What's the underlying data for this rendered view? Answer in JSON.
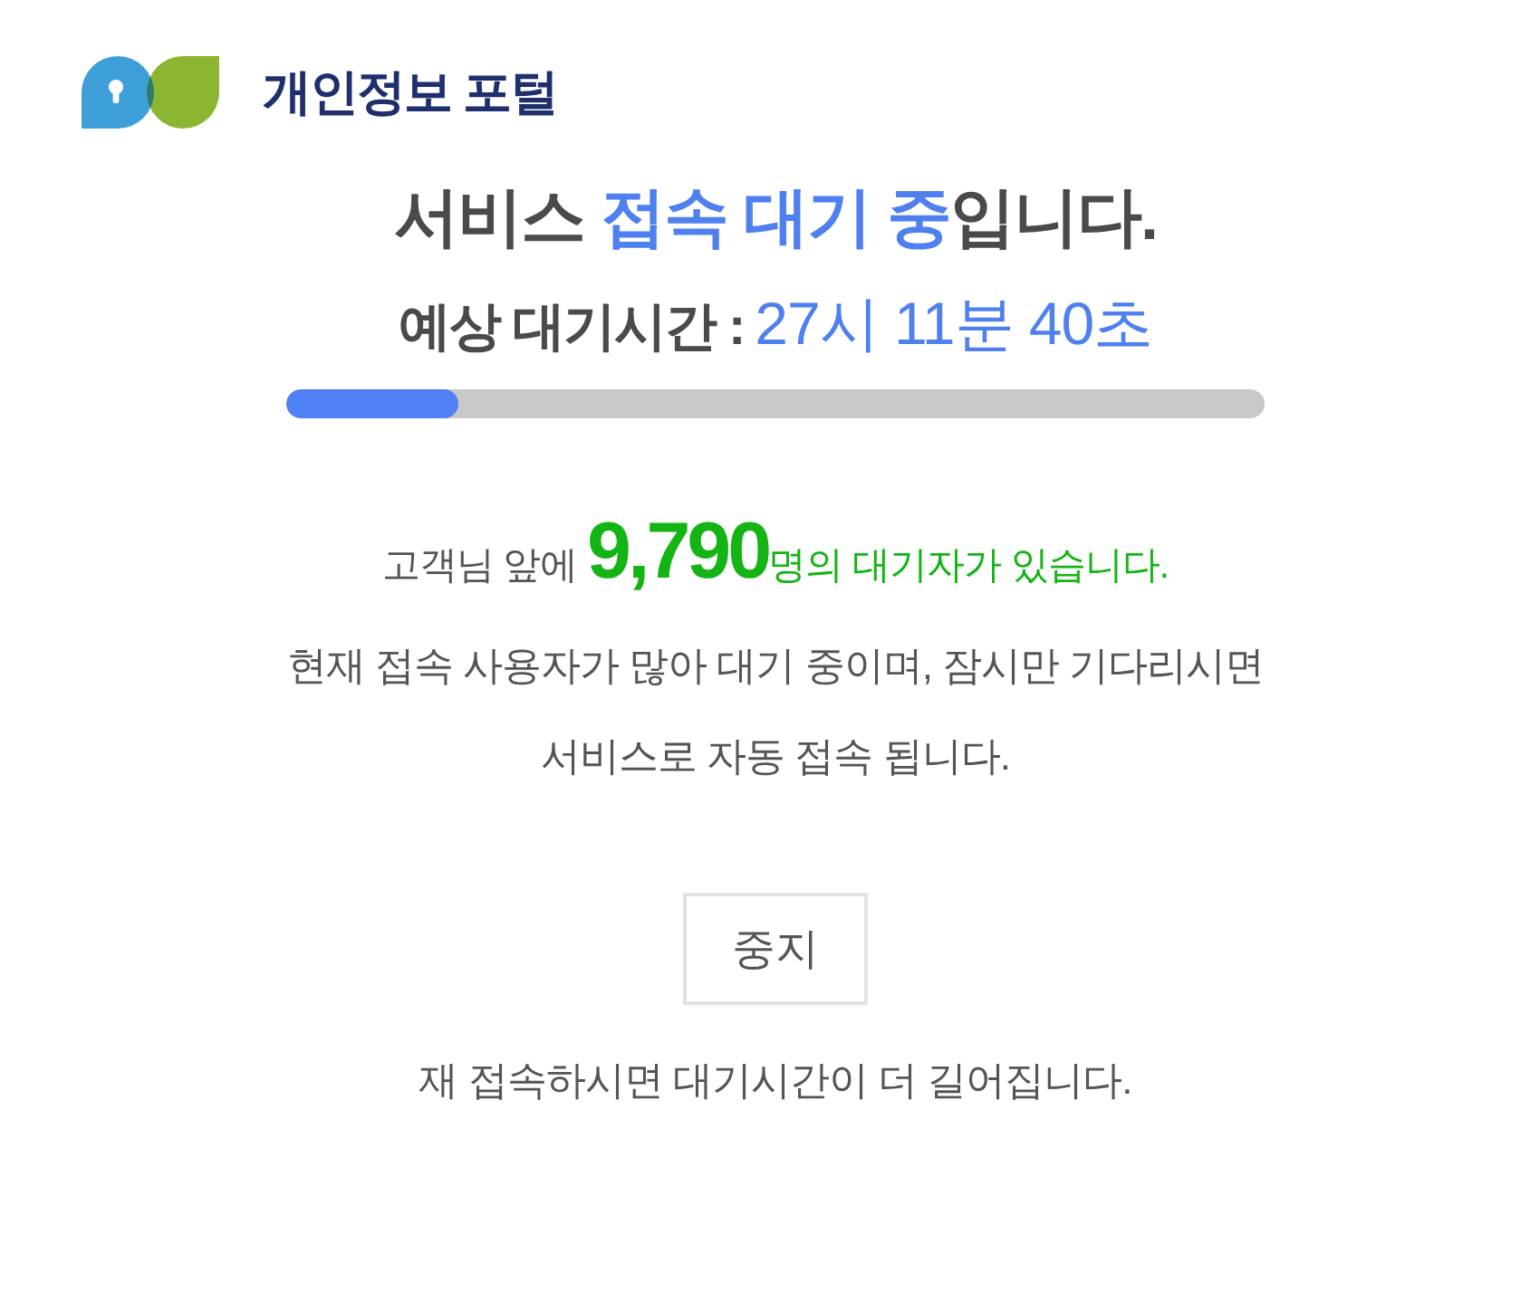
{
  "header": {
    "logo_text": "개인정보 포털"
  },
  "title": {
    "segments": [
      {
        "text": "서비스 ",
        "highlight": false
      },
      {
        "text": "접속 대기 중",
        "highlight": true
      },
      {
        "text": "입니다.",
        "highlight": false
      }
    ]
  },
  "estimate": {
    "label": "예상 대기시간 :",
    "value": "27시 11분 40초"
  },
  "progress": {
    "level": 0.176
  },
  "queue": {
    "segments": [
      {
        "kind": "plain",
        "text": "고객님 앞에 "
      },
      {
        "kind": "count",
        "text": "9,790"
      },
      {
        "kind": "accent",
        "text": "명의 대기자가 있습니다."
      }
    ]
  },
  "message_lines": [
    "현재 접속 사용자가 많아 대기 중이며, 잠시만 기다리시면",
    "서비스로 자동 접속 됩니다."
  ],
  "stop_button": {
    "label": "중지"
  },
  "notice": "재 접속하시면 대기시간이 더 길어집니다."
}
